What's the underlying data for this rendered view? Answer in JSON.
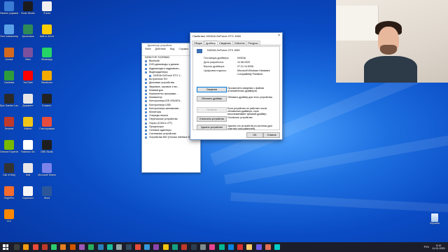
{
  "desktop_icons": [
    {
      "label": "Панель управления",
      "color": "#3a7bd5"
    },
    {
      "label": "Sonic Studio",
      "color": "#1c1c1c"
    },
    {
      "label": "iTunes",
      "color": "#f0f0f0"
    },
    {
      "label": "Этот компьютер",
      "color": "#5aa0e8"
    },
    {
      "label": "Кроссовок",
      "color": "#2e8b57"
    },
    {
      "label": "Mail.ru Агент",
      "color": "#ffcc00"
    },
    {
      "label": "Aumsa",
      "color": "#d2691e"
    },
    {
      "label": "Viber",
      "color": "#7b519d"
    },
    {
      "label": "WhatsApp",
      "color": "#25d366"
    },
    {
      "label": "Camtasia",
      "color": "#2d9c3c"
    },
    {
      "label": "YouTube",
      "color": "#ff0000"
    },
    {
      "label": "Bandicam",
      "color": "#f2a900"
    },
    {
      "label": "Epic Games Launcher",
      "color": "#2a2a2a"
    },
    {
      "label": "Документ",
      "color": "#e6e6e6"
    },
    {
      "label": "Блокнот",
      "color": "#222"
    },
    {
      "label": "Sentinel",
      "color": "#c0392b"
    },
    {
      "label": "Файлы",
      "color": "#f0c419"
    },
    {
      "label": "Пиктограмма",
      "color": "#e74c3c"
    },
    {
      "label": "Geforce Experience",
      "color": "#76b900"
    },
    {
      "label": "Rainbow Six",
      "color": "#fff"
    },
    {
      "label": "OBS Studio",
      "color": "#1e1e1e"
    },
    {
      "label": "Call of Duty",
      "color": "#333"
    },
    {
      "label": "Mail",
      "color": "#e6e6e6"
    },
    {
      "label": "Microsoft Teams",
      "color": "#7b83eb"
    },
    {
      "label": "OriginPro",
      "color": "#f56c2d"
    },
    {
      "label": "Скриншот",
      "color": "#f5f5f5"
    },
    {
      "label": "Word",
      "color": "#2b579a"
    },
    {
      "label": "VLC",
      "color": "#ff8800"
    }
  ],
  "device_manager": {
    "title": "Диспетчер устройств",
    "menu": [
      "Файл",
      "Действие",
      "Вид",
      "Справка"
    ],
    "tree": [
      "DESKTOP-7G2P8MO",
      "Bluetooth",
      "DVD-дисководы и дисков...",
      "Аудиовходы и аудиовыхо...",
      "Видеоадаптеры",
      "NVIDIA GeForce GTX 1...",
      "Встроенное ПО",
      "Дисковые устройства",
      "Звуковые, игровые и ви...",
      "Клавиатуры",
      "Компоненты программ...",
      "Компьютер",
      "Контроллеры IDE ATA/ATA...",
      "Контроллеры USB",
      "Контроллеры запоминаю...",
      "Мониторы",
      "Очереди печати",
      "Переносные устройства",
      "Порты (COM и LPT)",
      "Процессоры",
      "Сетевые адаптеры",
      "Системные устройства",
      "Устройства HID (Human Interface Devices)"
    ]
  },
  "dialog": {
    "title": "Свойства: NVIDIA GeForce GTX 1060",
    "close": "×",
    "tabs": [
      "Общие",
      "Драйвер",
      "Сведения",
      "События",
      "Ресурсы"
    ],
    "device_name": "NVIDIA GeForce GTX 1060",
    "props": [
      {
        "k": "Поставщик драйвера:",
        "v": "NVIDIA"
      },
      {
        "k": "Дата разработки:",
        "v": "12.08.2020"
      },
      {
        "k": "Версия драйвера:",
        "v": "27.21.14.5206"
      },
      {
        "k": "Цифровая подпись:",
        "v": "Microsoft Windows Hardware Compatibility Publisher"
      }
    ],
    "buttons": [
      {
        "label": "Сведения",
        "desc": "Просмотреть сведения о файлах установленных драйверов.",
        "state": "focus"
      },
      {
        "label": "Обновить драйвер",
        "desc": "Обновить драйвер для этого устройства.",
        "state": "normal"
      },
      {
        "label": "Откатить",
        "desc": "Если устройство не работает после обновления драйвера, откат восстанавливает прежний драйвер.",
        "state": "disabled"
      },
      {
        "label": "Отключить устройство",
        "desc": "Отключить устройство.",
        "state": "normal"
      },
      {
        "label": "Удалить устройство",
        "desc": "Удалить это устройство из системы (для опытных пользователей).",
        "state": "normal"
      }
    ],
    "ok": "OK",
    "cancel": "Отмена"
  },
  "recycle_bin": {
    "label": "Корзина"
  },
  "taskbar": {
    "apps": [
      "#3d3d3d",
      "#f39c12",
      "#e74c3c",
      "#c0392b",
      "#2ecc71",
      "#e67e22",
      "#d35400",
      "#9b59b6",
      "#27ae60",
      "#2980b9",
      "#1abc9c",
      "#95a5a6",
      "#34495e",
      "#e74c3c",
      "#3498db",
      "#8e44ad",
      "#f1c40f",
      "#16a085",
      "#c0392b",
      "#2c3e50",
      "#7f8c8d",
      "#e84393",
      "#00b894",
      "#0984e3",
      "#d63031",
      "#fdcb6e",
      "#6c5ce7",
      "#e17055",
      "#00cec9"
    ],
    "lang": "РУС",
    "time": "9:12",
    "date": "11.01.2021"
  }
}
